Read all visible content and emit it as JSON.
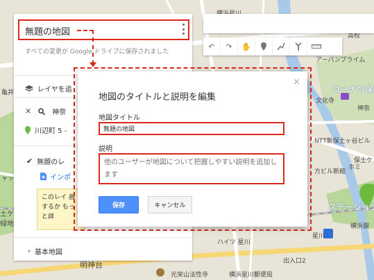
{
  "map": {
    "labels": {
      "yokohama_hoshikawa": "横浜星川",
      "kainan_high": "高校",
      "shinagawa": "品",
      "ap_apartment": "アーバンプライム",
      "conan": "コーナン保",
      "bunkasha": "文化寺",
      "kamishin": "神奈",
      "ntt": "NTT新保土ヶ谷ビル",
      "hodogaya": "保土ケ",
      "homi": "ホミ",
      "building": "方ビル新館",
      "station": "ステーション",
      "yokohama_bank": "横浜銀",
      "hoshikawa": "星川",
      "heights": "ハイツ 星川",
      "meiji": "明神台",
      "entrance": "出入口2",
      "temple": "光栄山法性寺",
      "post_office": "横浜星川郵便局",
      "kaigi": "土ケ",
      "ryokuchi": "緑地",
      "jack": "ャッ",
      "kamei": "亀井"
    }
  },
  "panel": {
    "title": "無題の地図",
    "save_note": "すべての変更が Google ドライブに保存されました",
    "layer_label": "レイヤを追",
    "search_label": "神奈",
    "pin_label": "川辺町 5 -",
    "untitled_layer": "無題のレ",
    "import_label": "インポ",
    "tip_text": "このレイ 画するか もっと詳",
    "base_map_label": "基本地図"
  },
  "dialog": {
    "heading": "地図のタイトルと説明を編集",
    "title_label": "地図タイトル",
    "title_value": "無題の地図",
    "desc_label": "説明",
    "desc_placeholder": "他のユーザーが地図について把握しやすい説明を追加します",
    "save_label": "保存",
    "cancel_label": "キャンセル",
    "close_glyph": "×"
  },
  "toolbar": {
    "undo_icon": "undo-icon",
    "redo_icon": "redo-icon",
    "hand_icon": "hand-icon",
    "marker_icon": "marker-icon",
    "line_icon": "draw-line-icon",
    "route_icon": "route-icon",
    "measure_icon": "ruler-icon"
  },
  "colors": {
    "annotation": "#d9271a",
    "accent": "#4d90fe",
    "panel_bg": "#ffffff",
    "map_bg": "#e8e2d6"
  }
}
